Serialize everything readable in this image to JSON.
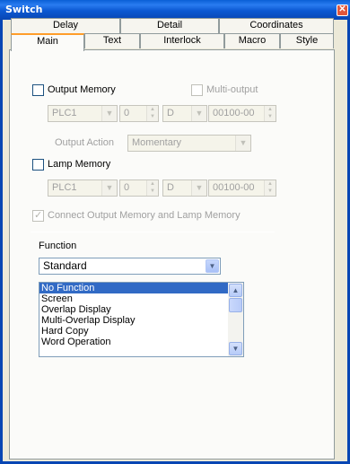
{
  "window": {
    "title": "Switch",
    "close_glyph": "✕"
  },
  "tabs": {
    "row_back": [
      "Delay",
      "Detail",
      "Coordinates"
    ],
    "row_front": [
      "Main",
      "Text",
      "Interlock",
      "Macro",
      "Style"
    ],
    "active": "Main"
  },
  "output": {
    "label": "Output Memory",
    "checked": false,
    "multi_label": "Multi-output",
    "plc": "PLC1",
    "number": "0",
    "device": "D",
    "address": "00100-00",
    "action_label": "Output Action",
    "action_value": "Momentary"
  },
  "lamp": {
    "label": "Lamp Memory",
    "checked": false,
    "plc": "PLC1",
    "number": "0",
    "device": "D",
    "address": "00100-00"
  },
  "connect": {
    "label": "Connect Output Memory and Lamp Memory",
    "checked": true
  },
  "function": {
    "label": "Function",
    "selected": "Standard",
    "list": [
      "No Function",
      "Screen",
      "Overlap Display",
      "Multi-Overlap Display",
      "Hard Copy",
      "Word Operation"
    ],
    "selected_index": 0
  },
  "glyphs": {
    "down": "▼",
    "up": "▲",
    "check": "✓"
  }
}
